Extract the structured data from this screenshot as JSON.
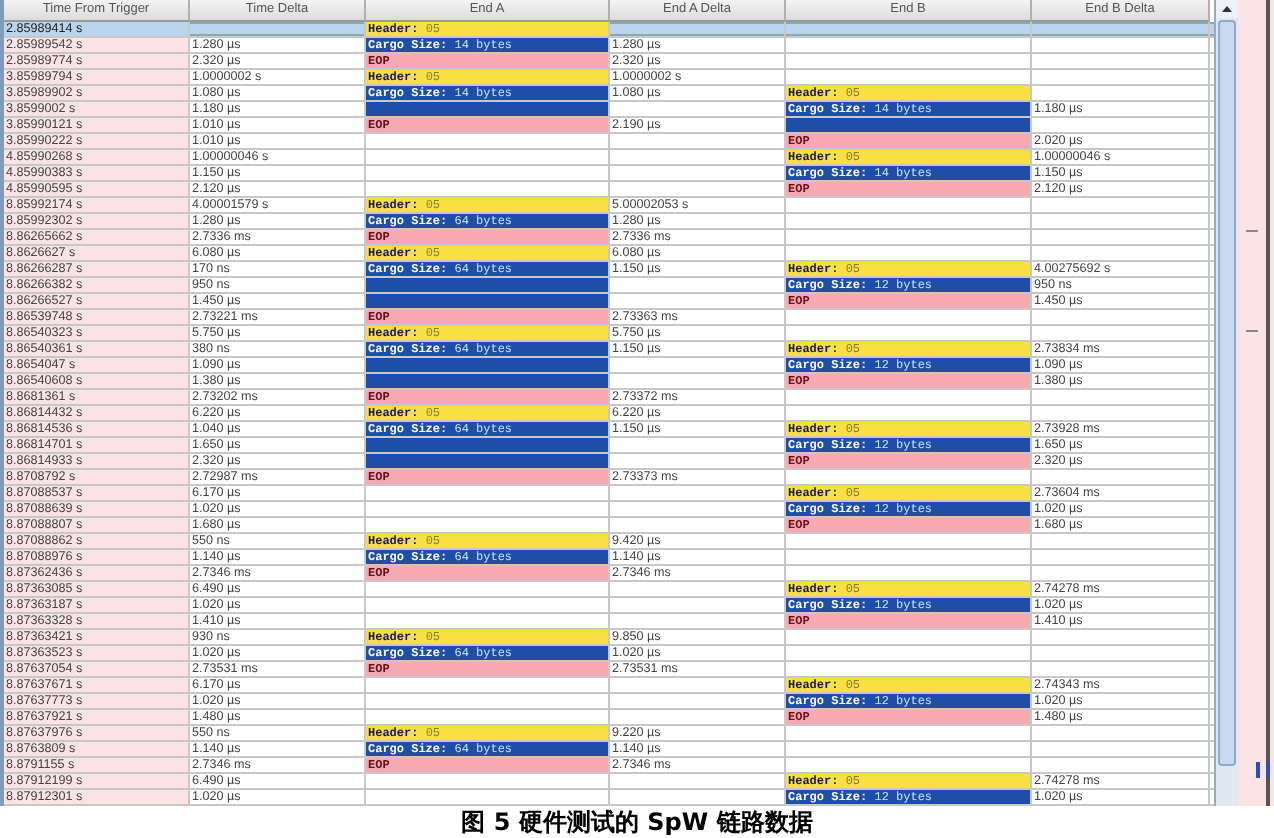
{
  "table": {
    "columns": [
      "Time From Trigger",
      "Time Delta",
      "End A",
      "End A Delta",
      "End B",
      "End B Delta"
    ],
    "rows": [
      {
        "selected": true,
        "t": "2.85989414 s",
        "a": {
          "kind": "header",
          "label": "Header:",
          "value": "05"
        }
      },
      {
        "selected": false,
        "t": "2.85989542 s",
        "d": "1.280 µs",
        "a": {
          "kind": "cargo",
          "label": "Cargo Size:",
          "value": "14 bytes"
        },
        "ad": "1.280 µs"
      },
      {
        "selected": false,
        "t": "2.85989774 s",
        "d": "2.320 µs",
        "a": {
          "kind": "eop",
          "label": "EOP"
        },
        "ad": "2.320 µs"
      },
      {
        "selected": false,
        "t": "3.85989794 s",
        "d": "1.0000002 s",
        "a": {
          "kind": "header",
          "label": "Header:",
          "value": "05"
        },
        "ad": "1.0000002 s"
      },
      {
        "selected": false,
        "t": "3.85989902 s",
        "d": "1.080 µs",
        "a": {
          "kind": "cargo",
          "label": "Cargo Size:",
          "value": "14 bytes"
        },
        "ad": "1.080 µs",
        "b": {
          "kind": "header",
          "label": "Header:",
          "value": "05"
        }
      },
      {
        "selected": false,
        "t": "3.8599002 s",
        "d": "1.180 µs",
        "a": {
          "kind": "cargo"
        },
        "b": {
          "kind": "cargo",
          "label": "Cargo Size:",
          "value": "14 bytes"
        },
        "bd": "1.180 µs"
      },
      {
        "selected": false,
        "t": "3.85990121 s",
        "d": "1.010 µs",
        "a": {
          "kind": "eop",
          "label": "EOP"
        },
        "ad": "2.190 µs",
        "b": {
          "kind": "cargo"
        }
      },
      {
        "selected": false,
        "t": "3.85990222 s",
        "d": "1.010 µs",
        "b": {
          "kind": "eop",
          "label": "EOP"
        },
        "bd": "2.020 µs"
      },
      {
        "selected": false,
        "t": "4.85990268 s",
        "d": "1.00000046 s",
        "b": {
          "kind": "header",
          "label": "Header:",
          "value": "05"
        },
        "bd": "1.00000046 s"
      },
      {
        "selected": false,
        "t": "4.85990383 s",
        "d": "1.150 µs",
        "b": {
          "kind": "cargo",
          "label": "Cargo Size:",
          "value": "14 bytes"
        },
        "bd": "1.150 µs"
      },
      {
        "selected": false,
        "t": "4.85990595 s",
        "d": "2.120 µs",
        "b": {
          "kind": "eop",
          "label": "EOP"
        },
        "bd": "2.120 µs"
      },
      {
        "selected": false,
        "t": "8.85992174 s",
        "d": "4.00001579 s",
        "a": {
          "kind": "header",
          "label": "Header:",
          "value": "05"
        },
        "ad": "5.00002053 s"
      },
      {
        "selected": false,
        "t": "8.85992302 s",
        "d": "1.280 µs",
        "a": {
          "kind": "cargo",
          "label": "Cargo Size:",
          "value": "64 bytes"
        },
        "ad": "1.280 µs"
      },
      {
        "selected": false,
        "t": "8.86265662 s",
        "d": "2.7336 ms",
        "a": {
          "kind": "eop",
          "label": "EOP"
        },
        "ad": "2.7336 ms"
      },
      {
        "selected": false,
        "t": "8.8626627 s",
        "d": "6.080 µs",
        "a": {
          "kind": "header",
          "label": "Header:",
          "value": "05"
        },
        "ad": "6.080 µs"
      },
      {
        "selected": false,
        "t": "8.86266287 s",
        "d": "170 ns",
        "a": {
          "kind": "cargo",
          "label": "Cargo Size:",
          "value": "64 bytes"
        },
        "ad": "1.150 µs",
        "b": {
          "kind": "header",
          "label": "Header:",
          "value": "05"
        },
        "bd": "4.00275692 s"
      },
      {
        "selected": false,
        "t": "8.86266382 s",
        "d": "950 ns",
        "a": {
          "kind": "cargo"
        },
        "b": {
          "kind": "cargo",
          "label": "Cargo Size:",
          "value": "12 bytes"
        },
        "bd": "950 ns"
      },
      {
        "selected": false,
        "t": "8.86266527 s",
        "d": "1.450 µs",
        "a": {
          "kind": "cargo"
        },
        "b": {
          "kind": "eop",
          "label": "EOP"
        },
        "bd": "1.450 µs"
      },
      {
        "selected": false,
        "t": "8.86539748 s",
        "d": "2.73221 ms",
        "a": {
          "kind": "eop",
          "label": "EOP"
        },
        "ad": "2.73363 ms"
      },
      {
        "selected": false,
        "t": "8.86540323 s",
        "d": "5.750 µs",
        "a": {
          "kind": "header",
          "label": "Header:",
          "value": "05"
        },
        "ad": "5.750 µs"
      },
      {
        "selected": false,
        "t": "8.86540361 s",
        "d": "380 ns",
        "a": {
          "kind": "cargo",
          "label": "Cargo Size:",
          "value": "64 bytes"
        },
        "ad": "1.150 µs",
        "b": {
          "kind": "header",
          "label": "Header:",
          "value": "05"
        },
        "bd": "2.73834 ms"
      },
      {
        "selected": false,
        "t": "8.8654047 s",
        "d": "1.090 µs",
        "a": {
          "kind": "cargo"
        },
        "b": {
          "kind": "cargo",
          "label": "Cargo Size:",
          "value": "12 bytes"
        },
        "bd": "1.090 µs"
      },
      {
        "selected": false,
        "t": "8.86540608 s",
        "d": "1.380 µs",
        "a": {
          "kind": "cargo"
        },
        "b": {
          "kind": "eop",
          "label": "EOP"
        },
        "bd": "1.380 µs"
      },
      {
        "selected": false,
        "t": "8.8681361 s",
        "d": "2.73202 ms",
        "a": {
          "kind": "eop",
          "label": "EOP"
        },
        "ad": "2.73372 ms"
      },
      {
        "selected": false,
        "t": "8.86814432 s",
        "d": "6.220 µs",
        "a": {
          "kind": "header",
          "label": "Header:",
          "value": "05"
        },
        "ad": "6.220 µs"
      },
      {
        "selected": false,
        "t": "8.86814536 s",
        "d": "1.040 µs",
        "a": {
          "kind": "cargo",
          "label": "Cargo Size:",
          "value": "64 bytes"
        },
        "ad": "1.150 µs",
        "b": {
          "kind": "header",
          "label": "Header:",
          "value": "05"
        },
        "bd": "2.73928 ms"
      },
      {
        "selected": false,
        "t": "8.86814701 s",
        "d": "1.650 µs",
        "a": {
          "kind": "cargo"
        },
        "b": {
          "kind": "cargo",
          "label": "Cargo Size:",
          "value": "12 bytes"
        },
        "bd": "1.650 µs"
      },
      {
        "selected": false,
        "t": "8.86814933 s",
        "d": "2.320 µs",
        "a": {
          "kind": "cargo"
        },
        "b": {
          "kind": "eop",
          "label": "EOP"
        },
        "bd": "2.320 µs"
      },
      {
        "selected": false,
        "t": "8.8708792 s",
        "d": "2.72987 ms",
        "a": {
          "kind": "eop",
          "label": "EOP"
        },
        "ad": "2.73373 ms"
      },
      {
        "selected": false,
        "t": "8.87088537 s",
        "d": "6.170 µs",
        "b": {
          "kind": "header",
          "label": "Header:",
          "value": "05"
        },
        "bd": "2.73604 ms"
      },
      {
        "selected": false,
        "t": "8.87088639 s",
        "d": "1.020 µs",
        "b": {
          "kind": "cargo",
          "label": "Cargo Size:",
          "value": "12 bytes"
        },
        "bd": "1.020 µs"
      },
      {
        "selected": false,
        "t": "8.87088807 s",
        "d": "1.680 µs",
        "b": {
          "kind": "eop",
          "label": "EOP"
        },
        "bd": "1.680 µs"
      },
      {
        "selected": false,
        "t": "8.87088862 s",
        "d": "550 ns",
        "a": {
          "kind": "header",
          "label": "Header:",
          "value": "05"
        },
        "ad": "9.420 µs"
      },
      {
        "selected": false,
        "t": "8.87088976 s",
        "d": "1.140 µs",
        "a": {
          "kind": "cargo",
          "label": "Cargo Size:",
          "value": "64 bytes"
        },
        "ad": "1.140 µs"
      },
      {
        "selected": false,
        "t": "8.87362436 s",
        "d": "2.7346 ms",
        "a": {
          "kind": "eop",
          "label": "EOP"
        },
        "ad": "2.7346 ms"
      },
      {
        "selected": false,
        "t": "8.87363085 s",
        "d": "6.490 µs",
        "b": {
          "kind": "header",
          "label": "Header:",
          "value": "05"
        },
        "bd": "2.74278 ms"
      },
      {
        "selected": false,
        "t": "8.87363187 s",
        "d": "1.020 µs",
        "b": {
          "kind": "cargo",
          "label": "Cargo Size:",
          "value": "12 bytes"
        },
        "bd": "1.020 µs"
      },
      {
        "selected": false,
        "t": "8.87363328 s",
        "d": "1.410 µs",
        "b": {
          "kind": "eop",
          "label": "EOP"
        },
        "bd": "1.410 µs"
      },
      {
        "selected": false,
        "t": "8.87363421 s",
        "d": "930 ns",
        "a": {
          "kind": "header",
          "label": "Header:",
          "value": "05"
        },
        "ad": "9.850 µs"
      },
      {
        "selected": false,
        "t": "8.87363523 s",
        "d": "1.020 µs",
        "a": {
          "kind": "cargo",
          "label": "Cargo Size:",
          "value": "64 bytes"
        },
        "ad": "1.020 µs"
      },
      {
        "selected": false,
        "t": "8.87637054 s",
        "d": "2.73531 ms",
        "a": {
          "kind": "eop",
          "label": "EOP"
        },
        "ad": "2.73531 ms"
      },
      {
        "selected": false,
        "t": "8.87637671 s",
        "d": "6.170 µs",
        "b": {
          "kind": "header",
          "label": "Header:",
          "value": "05"
        },
        "bd": "2.74343 ms"
      },
      {
        "selected": false,
        "t": "8.87637773 s",
        "d": "1.020 µs",
        "b": {
          "kind": "cargo",
          "label": "Cargo Size:",
          "value": "12 bytes"
        },
        "bd": "1.020 µs"
      },
      {
        "selected": false,
        "t": "8.87637921 s",
        "d": "1.480 µs",
        "b": {
          "kind": "eop",
          "label": "EOP"
        },
        "bd": "1.480 µs"
      },
      {
        "selected": false,
        "t": "8.87637976 s",
        "d": "550 ns",
        "a": {
          "kind": "header",
          "label": "Header:",
          "value": "05"
        },
        "ad": "9.220 µs"
      },
      {
        "selected": false,
        "t": "8.8763809 s",
        "d": "1.140 µs",
        "a": {
          "kind": "cargo",
          "label": "Cargo Size:",
          "value": "64 bytes"
        },
        "ad": "1.140 µs"
      },
      {
        "selected": false,
        "t": "8.8791155 s",
        "d": "2.7346 ms",
        "a": {
          "kind": "eop",
          "label": "EOP"
        },
        "ad": "2.7346 ms"
      },
      {
        "selected": false,
        "t": "8.87912199 s",
        "d": "6.490 µs",
        "b": {
          "kind": "header",
          "label": "Header:",
          "value": "05"
        },
        "bd": "2.74278 ms"
      },
      {
        "selected": false,
        "t": "8.87912301 s",
        "d": "1.020 µs",
        "b": {
          "kind": "cargo",
          "label": "Cargo Size:",
          "value": "12 bytes"
        },
        "bd": "1.020 µs"
      }
    ]
  },
  "caption": "图 5 硬件测试的 SpW 链路数据"
}
